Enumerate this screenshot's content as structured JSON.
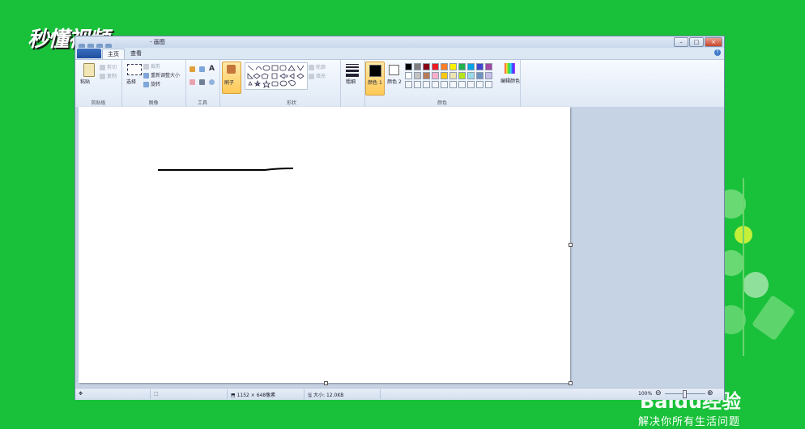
{
  "watermark": {
    "logo_text": "秒懂视频",
    "brand_text": "Baidu经验",
    "brand_sub": "解决你所有生活问题"
  },
  "window": {
    "title": "- 画图",
    "tabs": [
      {
        "label": "主页"
      },
      {
        "label": "查看"
      }
    ],
    "controls": {
      "minimize": "–",
      "maximize": "□",
      "close": "×"
    },
    "help_label": "?"
  },
  "ribbon": {
    "clipboard": {
      "label": "剪贴板",
      "paste": "粘贴",
      "cut": "剪切",
      "copy": "复制"
    },
    "image": {
      "label": "图像",
      "select": "选择",
      "crop": "裁剪",
      "resize": "重新调整大小",
      "rotate": "旋转"
    },
    "tools": {
      "label": "工具",
      "text_tool": "A"
    },
    "brushes": {
      "label": "刷子"
    },
    "shapes": {
      "label": "形状",
      "outline": "轮廓",
      "fill": "填充"
    },
    "size": {
      "label": "粗细"
    },
    "colors": {
      "label": "颜色",
      "color1": "颜色 1",
      "color2": "颜色 2",
      "edit": "编辑颜色",
      "color1_value": "#000000",
      "color2_value": "#ffffff",
      "palette_row1": [
        "#000000",
        "#7f7f7f",
        "#880015",
        "#ed1c24",
        "#ff7f27",
        "#fff200",
        "#22b14c",
        "#00a2e8",
        "#3f48cc",
        "#a349a4"
      ],
      "palette_row2": [
        "#ffffff",
        "#c3c3c3",
        "#b97a57",
        "#ffaec9",
        "#ffc90e",
        "#efe4b0",
        "#b5e61d",
        "#99d9ea",
        "#7092be",
        "#c8bfe7"
      ]
    }
  },
  "status": {
    "dimensions": "1152 × 648像素",
    "size": "大小: 12.0KB",
    "zoom": "100%"
  }
}
